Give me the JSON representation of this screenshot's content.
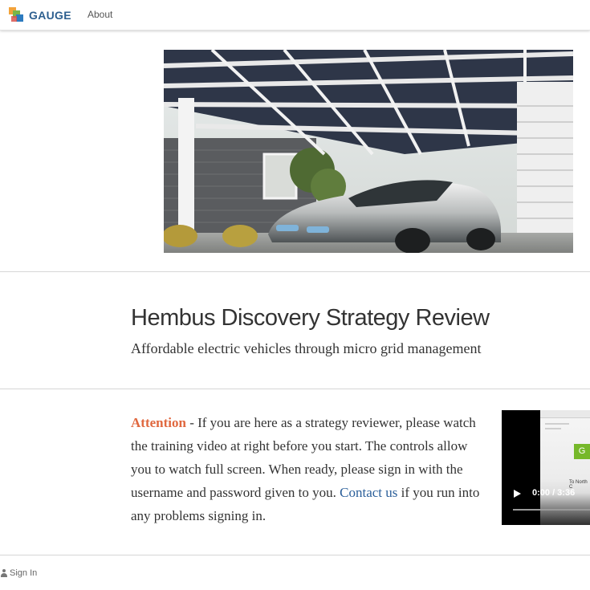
{
  "header": {
    "brand_name": "GAUGE",
    "nav_about": "About"
  },
  "hero": {
    "image": "electric-car-under-solar-carport"
  },
  "project": {
    "title": "Hembus Discovery Strategy Review",
    "subtitle": "Affordable electric vehicles through micro grid management"
  },
  "notice": {
    "attention_label": "Attention",
    "body": " - If you are here as a strategy reviewer, please watch the training video at right before you start. The controls allow you to watch full screen. When ready, please sign in with the username and password given to you. ",
    "contact_link": "Contact us",
    "body_end": " if you run into any problems signing in."
  },
  "video": {
    "time": "0:00 / 3:36",
    "thumb_button": "G",
    "thumb_text": "To North C"
  },
  "footer": {
    "signin_label": "Sign In"
  },
  "colors": {
    "accent_attention": "#e0683f",
    "link": "#2b5f9a",
    "brand": "#2d5f8f"
  }
}
